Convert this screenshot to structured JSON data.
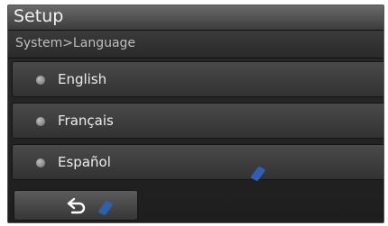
{
  "header": {
    "title": "Setup"
  },
  "breadcrumb": {
    "text": "System>Language"
  },
  "options": [
    {
      "label": "English"
    },
    {
      "label": "Français"
    },
    {
      "label": "Español"
    }
  ],
  "footer": {
    "back_icon": "back-arrow-icon"
  },
  "colors": {
    "accent": "#2f5fb3",
    "background": "#1e1e1e"
  }
}
